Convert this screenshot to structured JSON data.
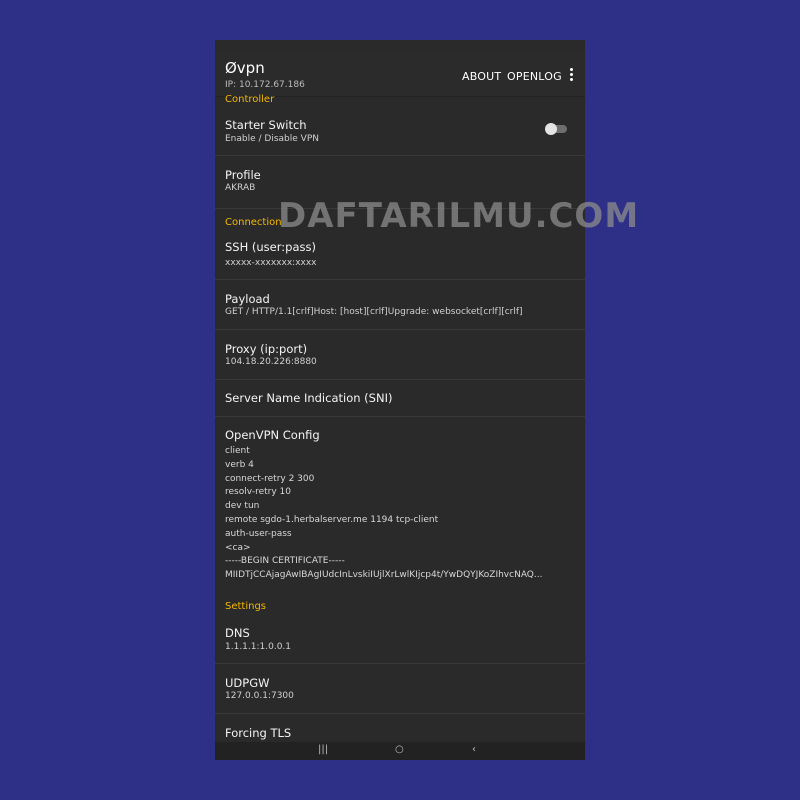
{
  "app": {
    "title": "Øvpn",
    "ip": "IP: 10.172.67.186",
    "actions": {
      "about": "ABOUT",
      "openlog": "OPENLOG"
    }
  },
  "sections": {
    "controller": "Controller",
    "connection": "Connection",
    "settings": "Settings"
  },
  "prefs": {
    "starter": {
      "title": "Starter Switch",
      "summary": "Enable / Disable VPN",
      "enabled": false
    },
    "profile": {
      "title": "Profile",
      "summary": "AKRAB"
    },
    "ssh": {
      "title": "SSH (user:pass)",
      "summary": "xxxxx-xxxxxxx:xxxx"
    },
    "payload": {
      "title": "Payload",
      "summary": "GET / HTTP/1.1[crlf]Host: [host][crlf]Upgrade: websocket[crlf][crlf]"
    },
    "proxy": {
      "title": "Proxy (ip:port)",
      "summary": "104.18.20.226:8880"
    },
    "sni": {
      "title": "Server Name Indication (SNI)"
    },
    "openvpn": {
      "title": "OpenVPN Config",
      "lines": [
        "client",
        "verb 4",
        "connect-retry 2 300",
        "resolv-retry 10",
        "dev tun",
        "remote sgdo-1.herbalserver.me 1194 tcp-client",
        "auth-user-pass",
        "<ca>",
        "-----BEGIN CERTIFICATE-----",
        "MIIDTjCCAjagAwIBAgIUdcInLvskiIUjlXrLwlKIjcp4t/YwDQYJKoZIhvcNAQ..."
      ]
    },
    "dns": {
      "title": "DNS",
      "summary": "1.1.1.1:1.0.0.1"
    },
    "udpgw": {
      "title": "UDPGW",
      "summary": "127.0.0.1:7300"
    },
    "forcing_tls": {
      "title": "Forcing TLS"
    }
  },
  "watermark": "DAFTARILMU.COM",
  "icons": {
    "menu": "more-vert-icon",
    "nav_recent": "recent-apps-icon",
    "nav_home": "home-icon",
    "nav_back": "back-icon"
  },
  "colors": {
    "background": "#2e2f86",
    "panel": "#2a2a2a",
    "section_accent": "#f5b700"
  }
}
